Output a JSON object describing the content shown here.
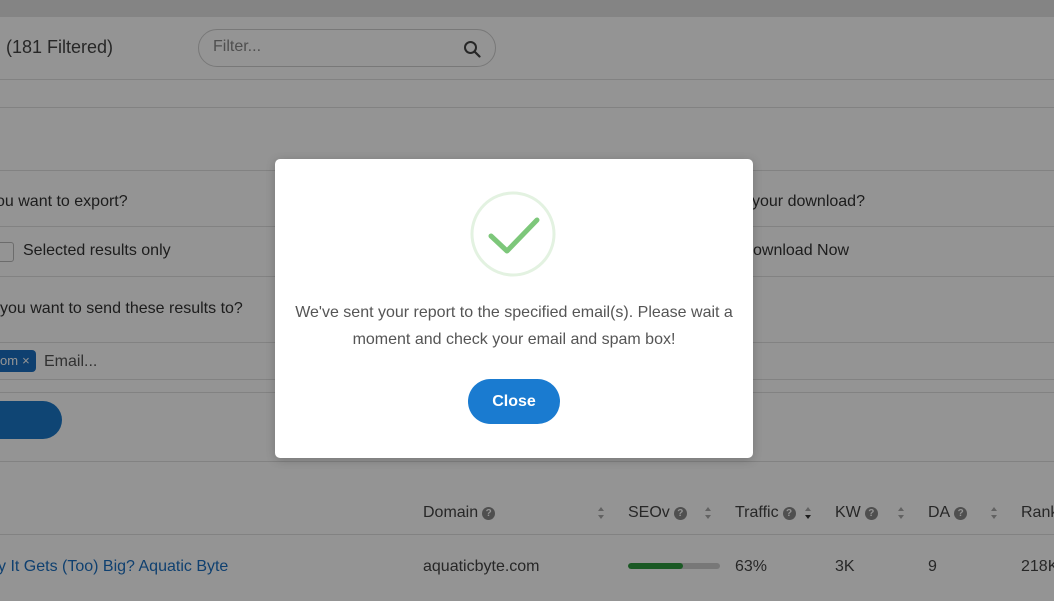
{
  "header": {
    "filtered_label": "(181 Filtered)",
    "filter_placeholder": "Filter..."
  },
  "export_form": {
    "question_export": "ou want to export?",
    "option_selected_only": "Selected results only",
    "question_download": "your download?",
    "option_download_now": "ownload Now",
    "question_send_to": "you want to send these results to?",
    "email_tag": {
      "text": "om",
      "remove": "×"
    },
    "email_placeholder": "Email..."
  },
  "table": {
    "columns": [
      {
        "label": "Domain",
        "help": "?"
      },
      {
        "label": "SEOv",
        "help": "?"
      },
      {
        "label": "Traffic",
        "help": "?"
      },
      {
        "label": "KW",
        "help": "?"
      },
      {
        "label": "DA",
        "help": "?"
      },
      {
        "label": "Rank"
      }
    ],
    "rows": [
      {
        "title": "y It Gets (Too) Big? Aquatic Byte",
        "domain": "aquaticbyte.com",
        "seov_fraction": 0.6,
        "traffic": "63%",
        "kw": "3K",
        "da": "9",
        "rank": "218K"
      }
    ]
  },
  "modal": {
    "message": "We've sent your report to the specified email(s). Please wait a moment and check your email and spam box!",
    "close_label": "Close"
  },
  "colors": {
    "accent": "#1a7bd0",
    "success_check": "#7dc77a",
    "seov_fill": "#2e9a3e"
  },
  "icons": {
    "filter": "search-icon",
    "modal": "checkmark-icon"
  }
}
